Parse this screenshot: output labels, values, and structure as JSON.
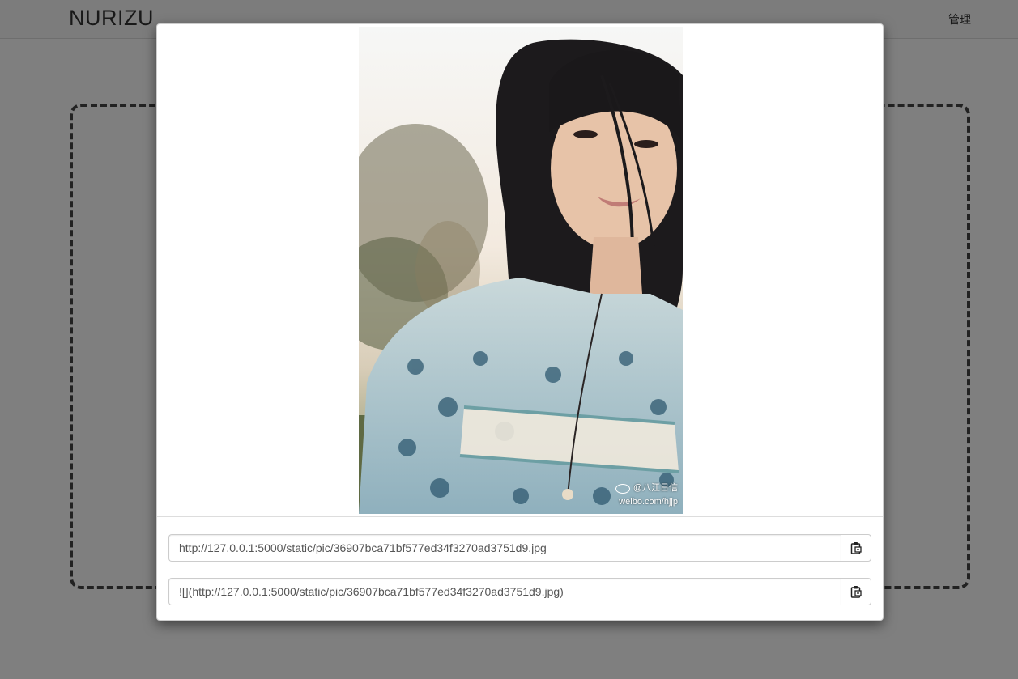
{
  "navbar": {
    "brand": "NURIZU",
    "manage_label": "管理"
  },
  "modal": {
    "photo": {
      "watermark_handle": "@八江日信",
      "watermark_site": "weibo.com/hjjp"
    },
    "links": [
      {
        "value": "http://127.0.0.1:5000/static/pic/36907bca71bf577ed34f3270ad3751d9.jpg",
        "copy_icon": "clipboard-icon"
      },
      {
        "value": "![](http://127.0.0.1:5000/static/pic/36907bca71bf577ed34f3270ad3751d9.jpg)",
        "copy_icon": "clipboard-icon"
      }
    ]
  },
  "colors": {
    "backdrop": "#000000",
    "dropzone_border": "#444444",
    "modal_bg": "#ffffff"
  }
}
